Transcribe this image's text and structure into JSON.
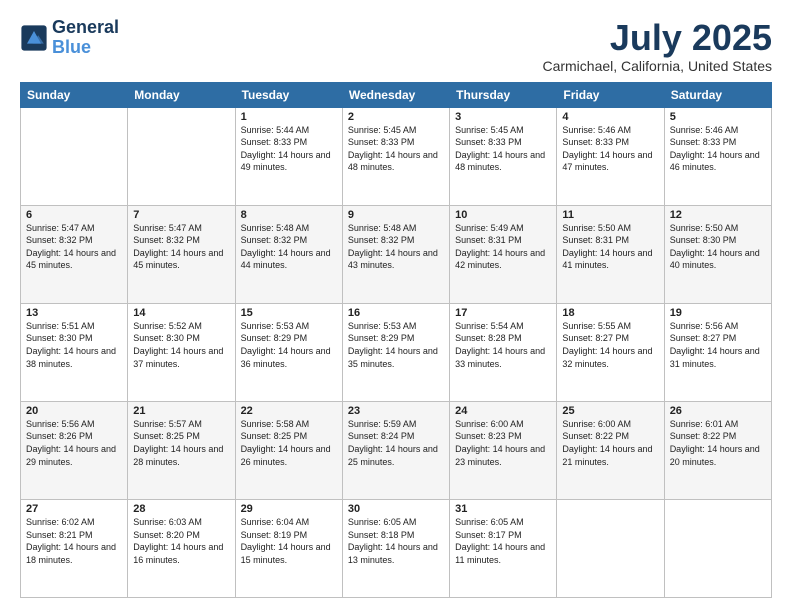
{
  "logo": {
    "line1": "General",
    "line2": "Blue"
  },
  "title": "July 2025",
  "location": "Carmichael, California, United States",
  "headers": [
    "Sunday",
    "Monday",
    "Tuesday",
    "Wednesday",
    "Thursday",
    "Friday",
    "Saturday"
  ],
  "weeks": [
    [
      {
        "day": "",
        "sunrise": "",
        "sunset": "",
        "daylight": ""
      },
      {
        "day": "",
        "sunrise": "",
        "sunset": "",
        "daylight": ""
      },
      {
        "day": "1",
        "sunrise": "Sunrise: 5:44 AM",
        "sunset": "Sunset: 8:33 PM",
        "daylight": "Daylight: 14 hours and 49 minutes."
      },
      {
        "day": "2",
        "sunrise": "Sunrise: 5:45 AM",
        "sunset": "Sunset: 8:33 PM",
        "daylight": "Daylight: 14 hours and 48 minutes."
      },
      {
        "day": "3",
        "sunrise": "Sunrise: 5:45 AM",
        "sunset": "Sunset: 8:33 PM",
        "daylight": "Daylight: 14 hours and 48 minutes."
      },
      {
        "day": "4",
        "sunrise": "Sunrise: 5:46 AM",
        "sunset": "Sunset: 8:33 PM",
        "daylight": "Daylight: 14 hours and 47 minutes."
      },
      {
        "day": "5",
        "sunrise": "Sunrise: 5:46 AM",
        "sunset": "Sunset: 8:33 PM",
        "daylight": "Daylight: 14 hours and 46 minutes."
      }
    ],
    [
      {
        "day": "6",
        "sunrise": "Sunrise: 5:47 AM",
        "sunset": "Sunset: 8:32 PM",
        "daylight": "Daylight: 14 hours and 45 minutes."
      },
      {
        "day": "7",
        "sunrise": "Sunrise: 5:47 AM",
        "sunset": "Sunset: 8:32 PM",
        "daylight": "Daylight: 14 hours and 45 minutes."
      },
      {
        "day": "8",
        "sunrise": "Sunrise: 5:48 AM",
        "sunset": "Sunset: 8:32 PM",
        "daylight": "Daylight: 14 hours and 44 minutes."
      },
      {
        "day": "9",
        "sunrise": "Sunrise: 5:48 AM",
        "sunset": "Sunset: 8:32 PM",
        "daylight": "Daylight: 14 hours and 43 minutes."
      },
      {
        "day": "10",
        "sunrise": "Sunrise: 5:49 AM",
        "sunset": "Sunset: 8:31 PM",
        "daylight": "Daylight: 14 hours and 42 minutes."
      },
      {
        "day": "11",
        "sunrise": "Sunrise: 5:50 AM",
        "sunset": "Sunset: 8:31 PM",
        "daylight": "Daylight: 14 hours and 41 minutes."
      },
      {
        "day": "12",
        "sunrise": "Sunrise: 5:50 AM",
        "sunset": "Sunset: 8:30 PM",
        "daylight": "Daylight: 14 hours and 40 minutes."
      }
    ],
    [
      {
        "day": "13",
        "sunrise": "Sunrise: 5:51 AM",
        "sunset": "Sunset: 8:30 PM",
        "daylight": "Daylight: 14 hours and 38 minutes."
      },
      {
        "day": "14",
        "sunrise": "Sunrise: 5:52 AM",
        "sunset": "Sunset: 8:30 PM",
        "daylight": "Daylight: 14 hours and 37 minutes."
      },
      {
        "day": "15",
        "sunrise": "Sunrise: 5:53 AM",
        "sunset": "Sunset: 8:29 PM",
        "daylight": "Daylight: 14 hours and 36 minutes."
      },
      {
        "day": "16",
        "sunrise": "Sunrise: 5:53 AM",
        "sunset": "Sunset: 8:29 PM",
        "daylight": "Daylight: 14 hours and 35 minutes."
      },
      {
        "day": "17",
        "sunrise": "Sunrise: 5:54 AM",
        "sunset": "Sunset: 8:28 PM",
        "daylight": "Daylight: 14 hours and 33 minutes."
      },
      {
        "day": "18",
        "sunrise": "Sunrise: 5:55 AM",
        "sunset": "Sunset: 8:27 PM",
        "daylight": "Daylight: 14 hours and 32 minutes."
      },
      {
        "day": "19",
        "sunrise": "Sunrise: 5:56 AM",
        "sunset": "Sunset: 8:27 PM",
        "daylight": "Daylight: 14 hours and 31 minutes."
      }
    ],
    [
      {
        "day": "20",
        "sunrise": "Sunrise: 5:56 AM",
        "sunset": "Sunset: 8:26 PM",
        "daylight": "Daylight: 14 hours and 29 minutes."
      },
      {
        "day": "21",
        "sunrise": "Sunrise: 5:57 AM",
        "sunset": "Sunset: 8:25 PM",
        "daylight": "Daylight: 14 hours and 28 minutes."
      },
      {
        "day": "22",
        "sunrise": "Sunrise: 5:58 AM",
        "sunset": "Sunset: 8:25 PM",
        "daylight": "Daylight: 14 hours and 26 minutes."
      },
      {
        "day": "23",
        "sunrise": "Sunrise: 5:59 AM",
        "sunset": "Sunset: 8:24 PM",
        "daylight": "Daylight: 14 hours and 25 minutes."
      },
      {
        "day": "24",
        "sunrise": "Sunrise: 6:00 AM",
        "sunset": "Sunset: 8:23 PM",
        "daylight": "Daylight: 14 hours and 23 minutes."
      },
      {
        "day": "25",
        "sunrise": "Sunrise: 6:00 AM",
        "sunset": "Sunset: 8:22 PM",
        "daylight": "Daylight: 14 hours and 21 minutes."
      },
      {
        "day": "26",
        "sunrise": "Sunrise: 6:01 AM",
        "sunset": "Sunset: 8:22 PM",
        "daylight": "Daylight: 14 hours and 20 minutes."
      }
    ],
    [
      {
        "day": "27",
        "sunrise": "Sunrise: 6:02 AM",
        "sunset": "Sunset: 8:21 PM",
        "daylight": "Daylight: 14 hours and 18 minutes."
      },
      {
        "day": "28",
        "sunrise": "Sunrise: 6:03 AM",
        "sunset": "Sunset: 8:20 PM",
        "daylight": "Daylight: 14 hours and 16 minutes."
      },
      {
        "day": "29",
        "sunrise": "Sunrise: 6:04 AM",
        "sunset": "Sunset: 8:19 PM",
        "daylight": "Daylight: 14 hours and 15 minutes."
      },
      {
        "day": "30",
        "sunrise": "Sunrise: 6:05 AM",
        "sunset": "Sunset: 8:18 PM",
        "daylight": "Daylight: 14 hours and 13 minutes."
      },
      {
        "day": "31",
        "sunrise": "Sunrise: 6:05 AM",
        "sunset": "Sunset: 8:17 PM",
        "daylight": "Daylight: 14 hours and 11 minutes."
      },
      {
        "day": "",
        "sunrise": "",
        "sunset": "",
        "daylight": ""
      },
      {
        "day": "",
        "sunrise": "",
        "sunset": "",
        "daylight": ""
      }
    ]
  ]
}
